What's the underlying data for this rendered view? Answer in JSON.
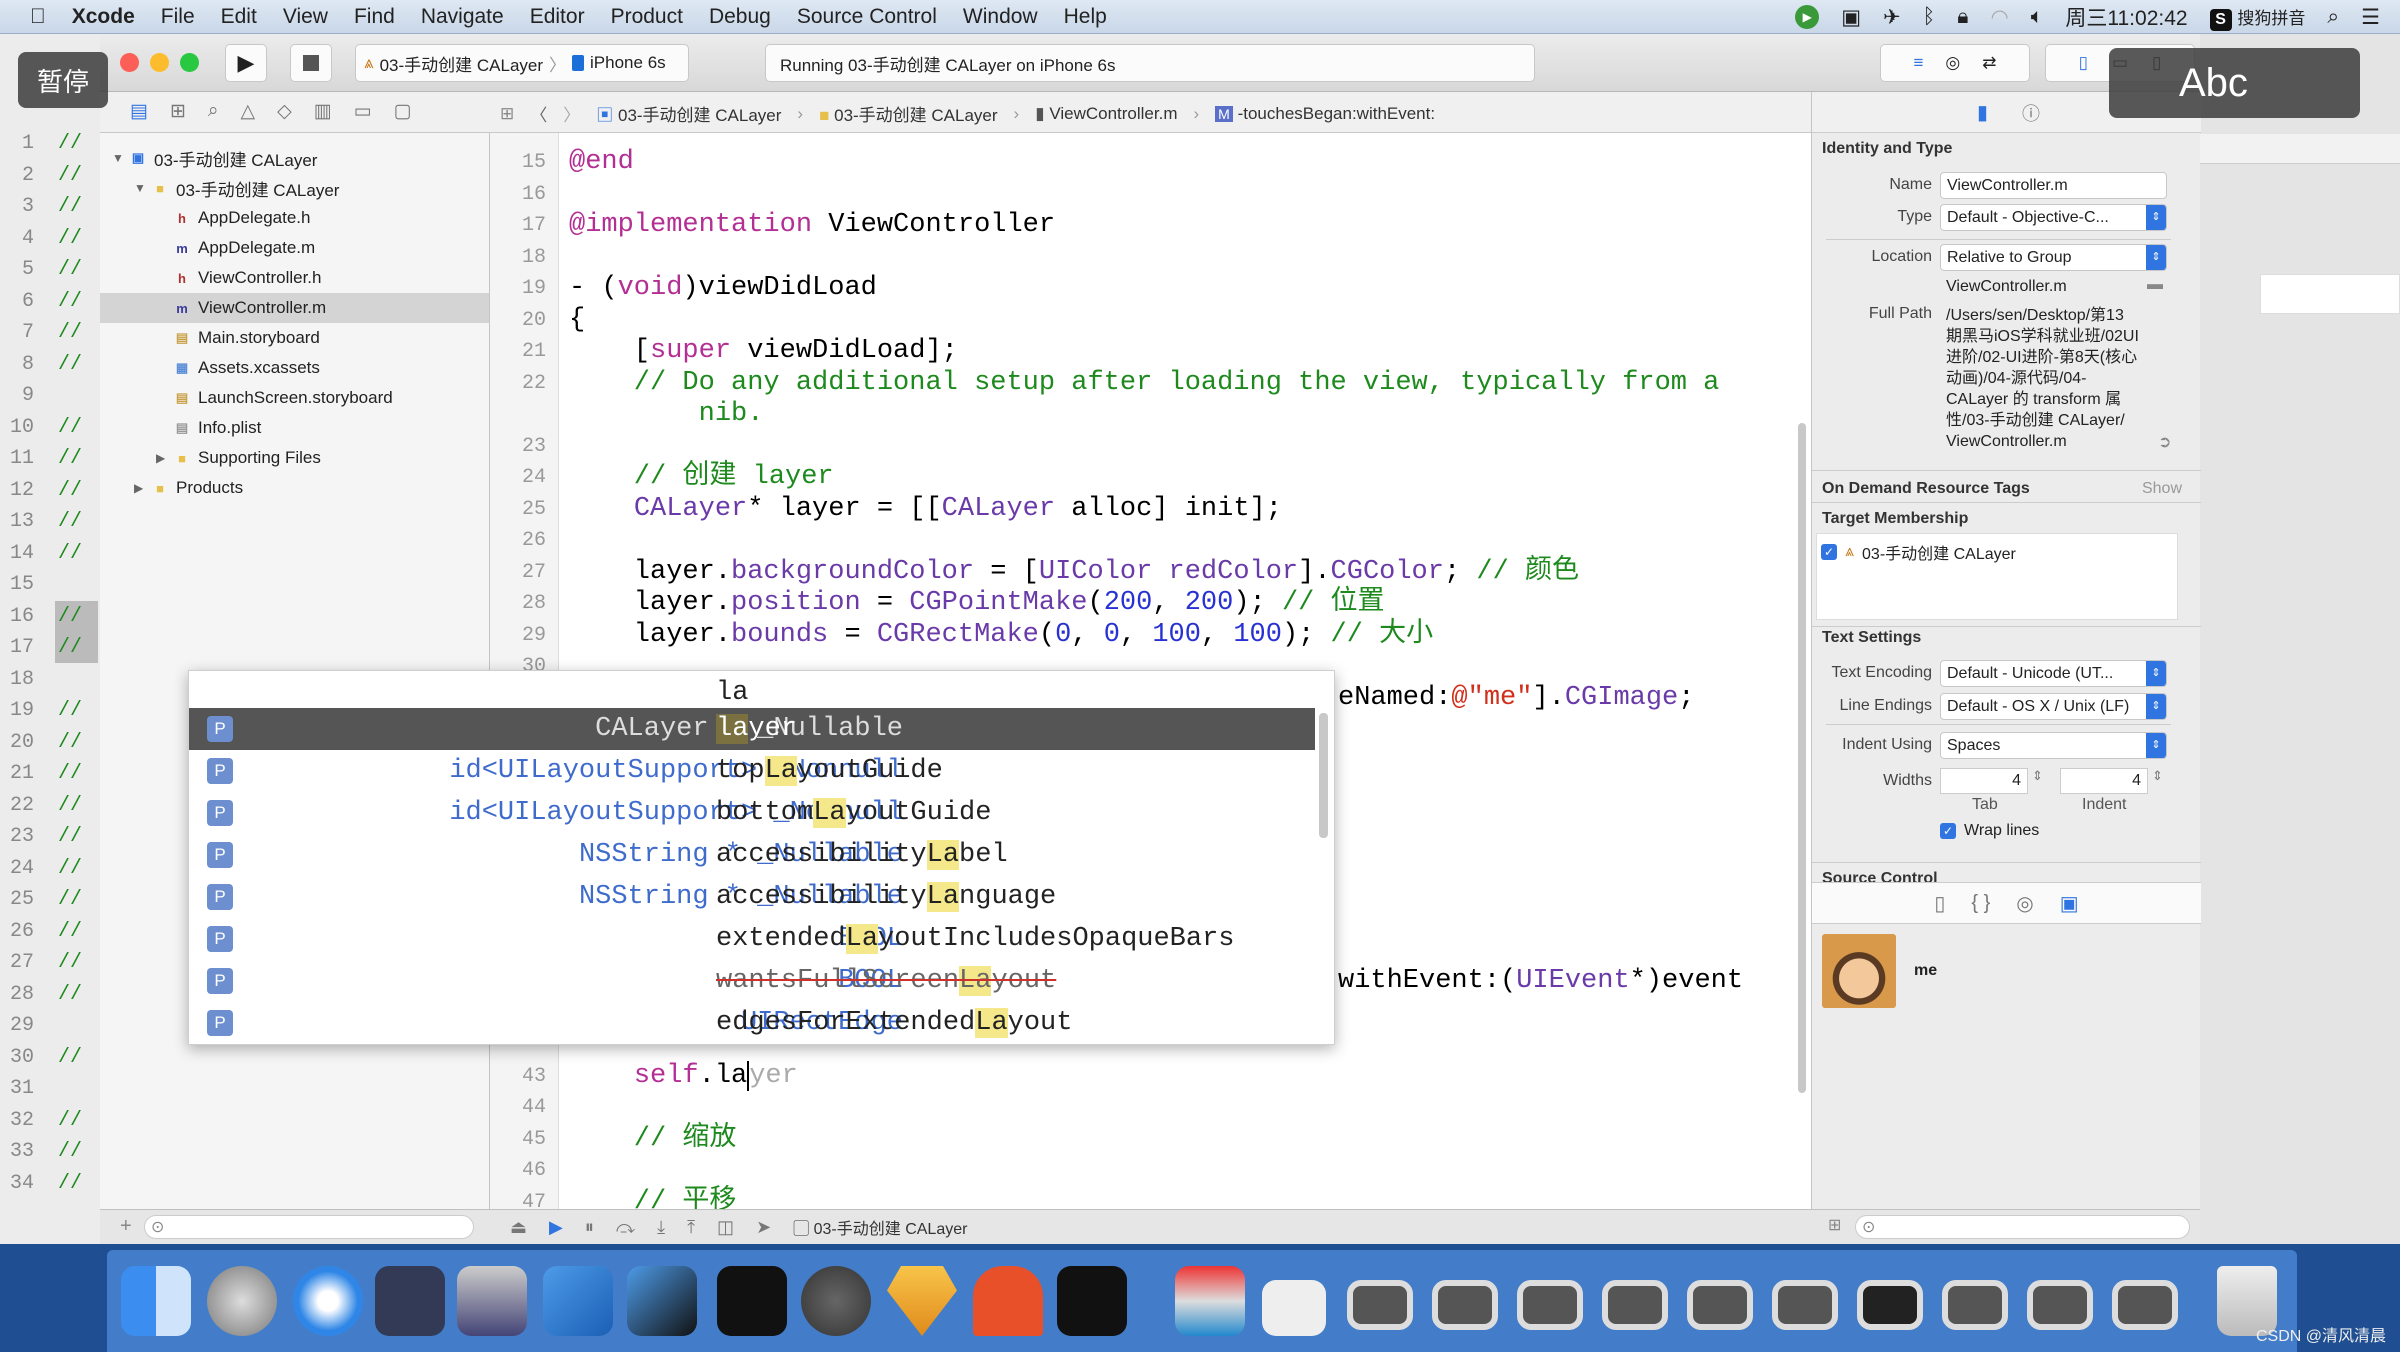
{
  "menubar": {
    "app": "Xcode",
    "items": [
      "File",
      "Edit",
      "View",
      "Find",
      "Navigate",
      "Editor",
      "Product",
      "Debug",
      "Source Control",
      "Window",
      "Help"
    ],
    "clock": "周三11:02:42",
    "ime": "搜狗拼音"
  },
  "overlays": {
    "pause": "暂停",
    "abc": "Abc"
  },
  "toolbar": {
    "scheme": "03-手动创建 CALayer",
    "device": "iPhone 6s",
    "status": "Running 03-手动创建 CALayer on iPhone 6s"
  },
  "jumpbar": [
    "03-手动创建 CALayer",
    "03-手动创建 CALayer",
    "ViewController.m",
    "-touchesBegan:withEvent:"
  ],
  "navigator": {
    "items": [
      {
        "label": "03-手动创建 CALayer",
        "kind": "project",
        "depth": 0,
        "disclosure": "open"
      },
      {
        "label": "03-手动创建 CALayer",
        "kind": "folder",
        "depth": 1,
        "disclosure": "open"
      },
      {
        "label": "AppDelegate.h",
        "kind": "h",
        "depth": 2
      },
      {
        "label": "AppDelegate.m",
        "kind": "m",
        "depth": 2
      },
      {
        "label": "ViewController.h",
        "kind": "h",
        "depth": 2
      },
      {
        "label": "ViewController.m",
        "kind": "m",
        "depth": 2,
        "selected": true
      },
      {
        "label": "Main.storyboard",
        "kind": "storyboard",
        "depth": 2
      },
      {
        "label": "Assets.xcassets",
        "kind": "assets",
        "depth": 2
      },
      {
        "label": "LaunchScreen.storyboard",
        "kind": "storyboard",
        "depth": 2
      },
      {
        "label": "Info.plist",
        "kind": "plist",
        "depth": 2
      },
      {
        "label": "Supporting Files",
        "kind": "folder",
        "depth": 2,
        "disclosure": "closed"
      },
      {
        "label": "Products",
        "kind": "folder",
        "depth": 1,
        "disclosure": "closed"
      }
    ]
  },
  "background_window": {
    "lines": [
      {
        "n": "1",
        "t": "//"
      },
      {
        "n": "2",
        "t": "//"
      },
      {
        "n": "3",
        "t": "//"
      },
      {
        "n": "4",
        "t": "//"
      },
      {
        "n": "5",
        "t": "//"
      },
      {
        "n": "6",
        "t": "//"
      },
      {
        "n": "7",
        "t": "//"
      },
      {
        "n": "8",
        "t": "//"
      },
      {
        "n": "9",
        "t": ""
      },
      {
        "n": "10",
        "t": "//"
      },
      {
        "n": "11",
        "t": "//"
      },
      {
        "n": "12",
        "t": "//"
      },
      {
        "n": "13",
        "t": "//"
      },
      {
        "n": "14",
        "t": "//"
      },
      {
        "n": "15",
        "t": ""
      },
      {
        "n": "16",
        "t": "//"
      },
      {
        "n": "17",
        "t": "//"
      },
      {
        "n": "18",
        "t": ""
      },
      {
        "n": "19",
        "t": "//"
      },
      {
        "n": "20",
        "t": "//"
      },
      {
        "n": "21",
        "t": "//"
      },
      {
        "n": "22",
        "t": "//"
      },
      {
        "n": "23",
        "t": "//"
      },
      {
        "n": "24",
        "t": "//"
      },
      {
        "n": "25",
        "t": "//"
      },
      {
        "n": "26",
        "t": "//"
      },
      {
        "n": "27",
        "t": "//"
      },
      {
        "n": "28",
        "t": "//"
      },
      {
        "n": "29",
        "t": ""
      },
      {
        "n": "30",
        "t": "//"
      },
      {
        "n": "31",
        "t": ""
      },
      {
        "n": "32",
        "t": "//"
      },
      {
        "n": "33",
        "t": "//"
      },
      {
        "n": "34",
        "t": "//"
      }
    ]
  },
  "editor": {
    "lines": [
      {
        "n": "15",
        "row": 0,
        "tokens": [
          [
            "@end",
            "k"
          ]
        ]
      },
      {
        "n": "16",
        "row": 1,
        "tokens": []
      },
      {
        "n": "17",
        "row": 2,
        "tokens": [
          [
            "@implementation",
            "k"
          ],
          [
            " ViewController",
            ""
          ]
        ]
      },
      {
        "n": "18",
        "row": 3,
        "tokens": []
      },
      {
        "n": "19",
        "row": 4,
        "tokens": [
          [
            "- (",
            ""
          ],
          [
            "void",
            "k"
          ],
          [
            ")viewDidLoad",
            ""
          ]
        ]
      },
      {
        "n": "20",
        "row": 5,
        "tokens": [
          [
            "{",
            ""
          ]
        ]
      },
      {
        "n": "21",
        "row": 6,
        "tokens": [
          [
            "    [",
            ""
          ],
          [
            "super",
            "k"
          ],
          [
            " viewDidLoad];",
            ""
          ]
        ]
      },
      {
        "n": "22",
        "row": 7,
        "tokens": [
          [
            "    // Do any additional setup after loading the view, typically from a",
            "c"
          ]
        ]
      },
      {
        "n": "",
        "row": 8,
        "tokens": [
          [
            "        nib.",
            "c"
          ]
        ]
      },
      {
        "n": "23",
        "row": 9,
        "tokens": []
      },
      {
        "n": "24",
        "row": 10,
        "tokens": [
          [
            "    // 创建 layer",
            "c"
          ]
        ]
      },
      {
        "n": "25",
        "row": 11,
        "tokens": [
          [
            "    ",
            ""
          ],
          [
            "CALayer",
            "t"
          ],
          [
            "* layer = [[",
            ""
          ],
          [
            "CALayer",
            "t"
          ],
          [
            " alloc] init];",
            ""
          ]
        ]
      },
      {
        "n": "26",
        "row": 12,
        "tokens": []
      },
      {
        "n": "27",
        "row": 13,
        "tokens": [
          [
            "    layer.",
            ""
          ],
          [
            "backgroundColor",
            "t"
          ],
          [
            " = [",
            ""
          ],
          [
            "UIColor",
            "t"
          ],
          [
            " ",
            ""
          ],
          [
            "redColor",
            "t"
          ],
          [
            "].",
            ""
          ],
          [
            "CGColor",
            "t"
          ],
          [
            "; ",
            ""
          ],
          [
            "// 颜色",
            "c"
          ]
        ]
      },
      {
        "n": "28",
        "row": 14,
        "tokens": [
          [
            "    layer.",
            ""
          ],
          [
            "position",
            "t"
          ],
          [
            " = ",
            ""
          ],
          [
            "CGPointMake",
            "t"
          ],
          [
            "(",
            ""
          ],
          [
            "200",
            "n"
          ],
          [
            ", ",
            ""
          ],
          [
            "200",
            "n"
          ],
          [
            "); ",
            ""
          ],
          [
            "// 位置",
            "c"
          ]
        ]
      },
      {
        "n": "29",
        "row": 15,
        "tokens": [
          [
            "    layer.",
            ""
          ],
          [
            "bounds",
            "t"
          ],
          [
            " = ",
            ""
          ],
          [
            "CGRectMake",
            "t"
          ],
          [
            "(",
            ""
          ],
          [
            "0",
            "n"
          ],
          [
            ", ",
            ""
          ],
          [
            "0",
            "n"
          ],
          [
            ", ",
            ""
          ],
          [
            "100",
            "n"
          ],
          [
            ", ",
            ""
          ],
          [
            "100",
            "n"
          ],
          [
            "); ",
            ""
          ],
          [
            "// 大小",
            "c"
          ]
        ]
      },
      {
        "n": "30",
        "row": 16,
        "tokens": []
      },
      {
        "n": "43",
        "row": 29,
        "tokens": [
          [
            "    ",
            ""
          ],
          [
            "self",
            "k"
          ],
          [
            ".la",
            ""
          ],
          [
            "",
            "cur"
          ],
          [
            "yer",
            "g"
          ]
        ]
      },
      {
        "n": "44",
        "row": 30,
        "tokens": []
      },
      {
        "n": "45",
        "row": 31,
        "tokens": [
          [
            "    // 缩放",
            "c"
          ]
        ]
      },
      {
        "n": "46",
        "row": 32,
        "tokens": []
      },
      {
        "n": "47",
        "row": 33,
        "tokens": [
          [
            "    // 平移",
            "c"
          ]
        ]
      }
    ],
    "partial_lines": [
      {
        "row": 17,
        "tokens": [
          [
            "eNamed:",
            ""
          ],
          [
            "@\"me\"",
            "s"
          ],
          [
            "].",
            ""
          ],
          [
            "CGImage",
            "t"
          ],
          [
            ";",
            ""
          ]
        ]
      },
      {
        "row": 26,
        "tokens": [
          [
            "withEvent:(",
            ""
          ],
          [
            "UIEvent",
            "t"
          ],
          [
            "*)event",
            ""
          ]
        ]
      }
    ]
  },
  "autocomplete": {
    "typed": "la",
    "items": [
      {
        "badge": "P",
        "type": "CALayer * _Nullable",
        "pre": "",
        "match": "la",
        "post": "yer",
        "selected": true
      },
      {
        "badge": "P",
        "type": "id<UILayoutSupport> _Nonnull",
        "pre": "top",
        "match": "La",
        "post": "youtGuide"
      },
      {
        "badge": "P",
        "type": "id<UILayoutSupport> _Nonnull",
        "pre": "bottom",
        "match": "La",
        "post": "youtGuide"
      },
      {
        "badge": "P",
        "type": "NSString * _Nullable",
        "pre": "accessibility",
        "match": "La",
        "post": "bel"
      },
      {
        "badge": "P",
        "type": "NSString * _Nullable",
        "pre": "accessibility",
        "match": "La",
        "post": "nguage"
      },
      {
        "badge": "P",
        "type": "BOOL",
        "pre": "extended",
        "match": "La",
        "post": "youtIncludesOpaqueBars"
      },
      {
        "badge": "P",
        "type": "BOOL",
        "pre": "wantsFullScreen",
        "match": "La",
        "post": "yout",
        "deprecated": true
      },
      {
        "badge": "P",
        "type": "UIRectEdge",
        "pre": "edgesForExtended",
        "match": "La",
        "post": "yout"
      }
    ]
  },
  "inspector": {
    "identity": {
      "title": "Identity and Type",
      "name_label": "Name",
      "name": "ViewController.m",
      "type_label": "Type",
      "type": "Default - Objective-C...",
      "location_label": "Location",
      "location": "Relative to Group",
      "relative_file": "ViewController.m",
      "fullpath_label": "Full Path",
      "fullpath_lines": [
        "/Users/sen/Desktop/第13",
        "期黑马iOS学科就业班/02UI",
        "进阶/02-UI进阶-第8天(核心",
        "动画)/04-源代码/04-",
        "CALayer 的 transform 属",
        "性/03-手动创建 CALayer/",
        "ViewController.m"
      ]
    },
    "odr": {
      "title": "On Demand Resource Tags",
      "show": "Show"
    },
    "target": {
      "title": "Target Membership",
      "item": "03-手动创建 CALayer",
      "checked": true
    },
    "text_settings": {
      "title": "Text Settings",
      "encoding_label": "Text Encoding",
      "encoding": "Default - Unicode (UT...",
      "endings_label": "Line Endings",
      "endings": "Default - OS X / Unix (LF)",
      "indent_label": "Indent Using",
      "indent": "Spaces",
      "widths_label": "Widths",
      "tab": "4",
      "indent_width": "4",
      "tab_label": "Tab",
      "indent_sub_label": "Indent",
      "wrap_label": "Wrap lines",
      "wrap": true
    },
    "source_control": "Source Control",
    "library_item": "me"
  },
  "debugbar": {
    "target": "03-手动创建 CALayer"
  },
  "watermark": "CSDN @清风清晨",
  "colors": {
    "accent": "#2f74e0",
    "selection": "#555555",
    "match_highlight": "#f4e88a"
  }
}
